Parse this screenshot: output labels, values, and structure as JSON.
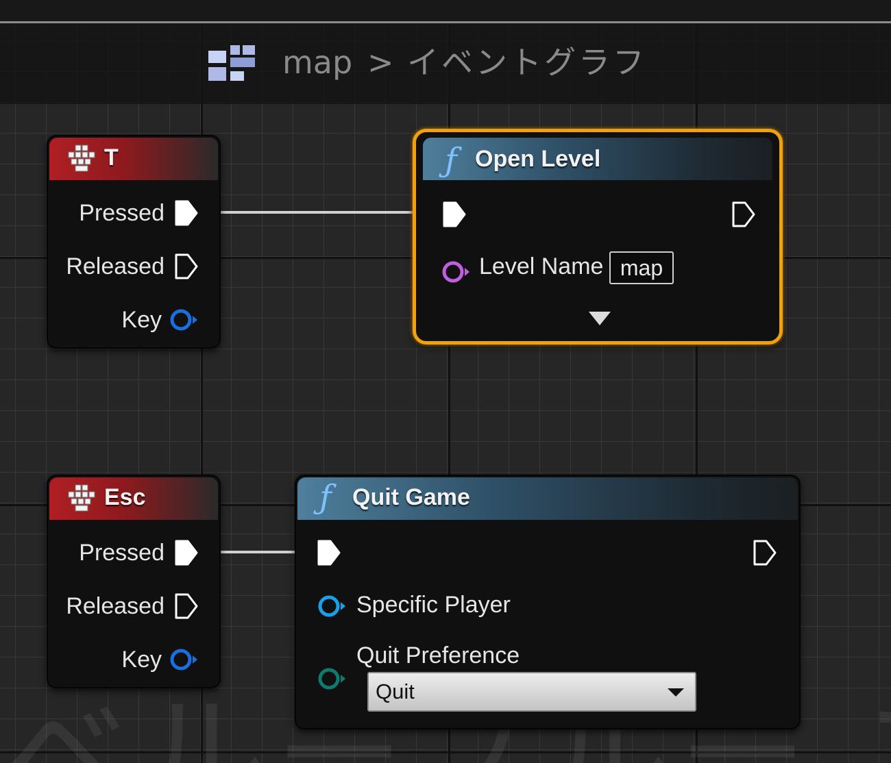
{
  "breadcrumb": {
    "asset": "map",
    "separator": ">",
    "graph": "イベントグラフ"
  },
  "watermark": "ベルーブルー プリ",
  "colors": {
    "selection": "#f0a20e",
    "exec_pin": "#ffffff",
    "object_pin": "#1a6fe0",
    "string_pin": "#c060e0",
    "enum_pin": "#117a6e",
    "event_header": "#b01e24",
    "function_header": "#4e7f9c"
  },
  "nodes": {
    "t_event": {
      "icon": "keyboard-key-icon",
      "title": "T",
      "pins": {
        "pressed": "Pressed",
        "released": "Released",
        "key": "Key"
      }
    },
    "open_level": {
      "icon": "function-icon",
      "title": "Open Level",
      "selected": true,
      "pins": {
        "level_name": "Level Name"
      },
      "level_name_value": "map",
      "advanced_toggle": "chevron-down-icon"
    },
    "esc_event": {
      "icon": "keyboard-key-icon",
      "title": "Esc",
      "pins": {
        "pressed": "Pressed",
        "released": "Released",
        "key": "Key"
      }
    },
    "quit_game": {
      "icon": "function-icon",
      "title": "Quit Game",
      "pins": {
        "specific_player": "Specific Player",
        "quit_preference": "Quit Preference"
      },
      "quit_preference_value": "Quit"
    }
  }
}
